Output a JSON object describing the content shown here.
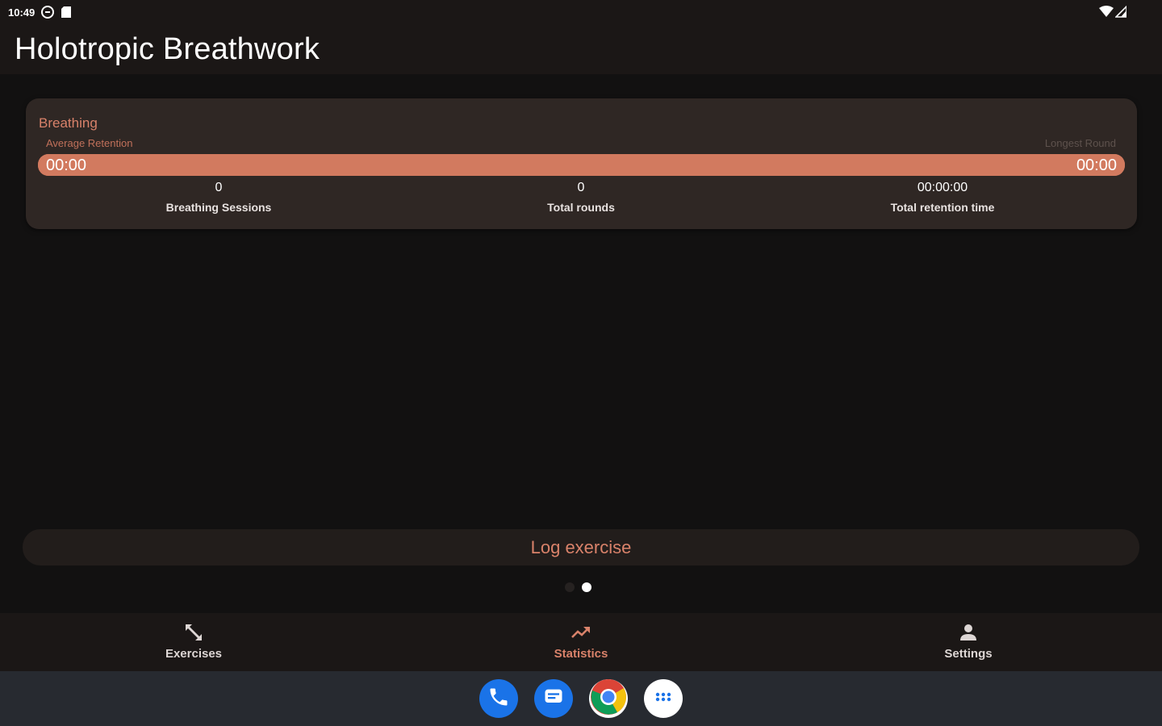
{
  "status_bar": {
    "time": "10:49"
  },
  "app": {
    "title": "Holotropic Breathwork"
  },
  "card": {
    "title": "Breathing",
    "avg_retention_label": "Average Retention",
    "longest_round_label": "Longest Round",
    "avg_retention_value": "00:00",
    "longest_round_value": "00:00",
    "progress_fraction": 1.0,
    "stats": [
      {
        "value": "0",
        "label": "Breathing Sessions"
      },
      {
        "value": "0",
        "label": "Total rounds"
      },
      {
        "value": "00:00:00",
        "label": "Total retention time"
      }
    ]
  },
  "log_button": {
    "label": "Log exercise"
  },
  "pager": {
    "count": 2,
    "active_index": 1
  },
  "bottom_nav": {
    "items": [
      {
        "label": "Exercises",
        "icon": "expand-arrows-icon",
        "active": false
      },
      {
        "label": "Statistics",
        "icon": "trending-up-icon",
        "active": true
      },
      {
        "label": "Settings",
        "icon": "person-icon",
        "active": false
      }
    ]
  },
  "dock": {
    "apps": [
      "phone-icon",
      "messages-icon",
      "chrome-icon",
      "app-drawer-icon"
    ]
  },
  "colors": {
    "accent": "#d27a5f",
    "accent_text": "#d9826a",
    "background": "#121111",
    "surface": "#1b1716",
    "card": "#2f2724"
  }
}
